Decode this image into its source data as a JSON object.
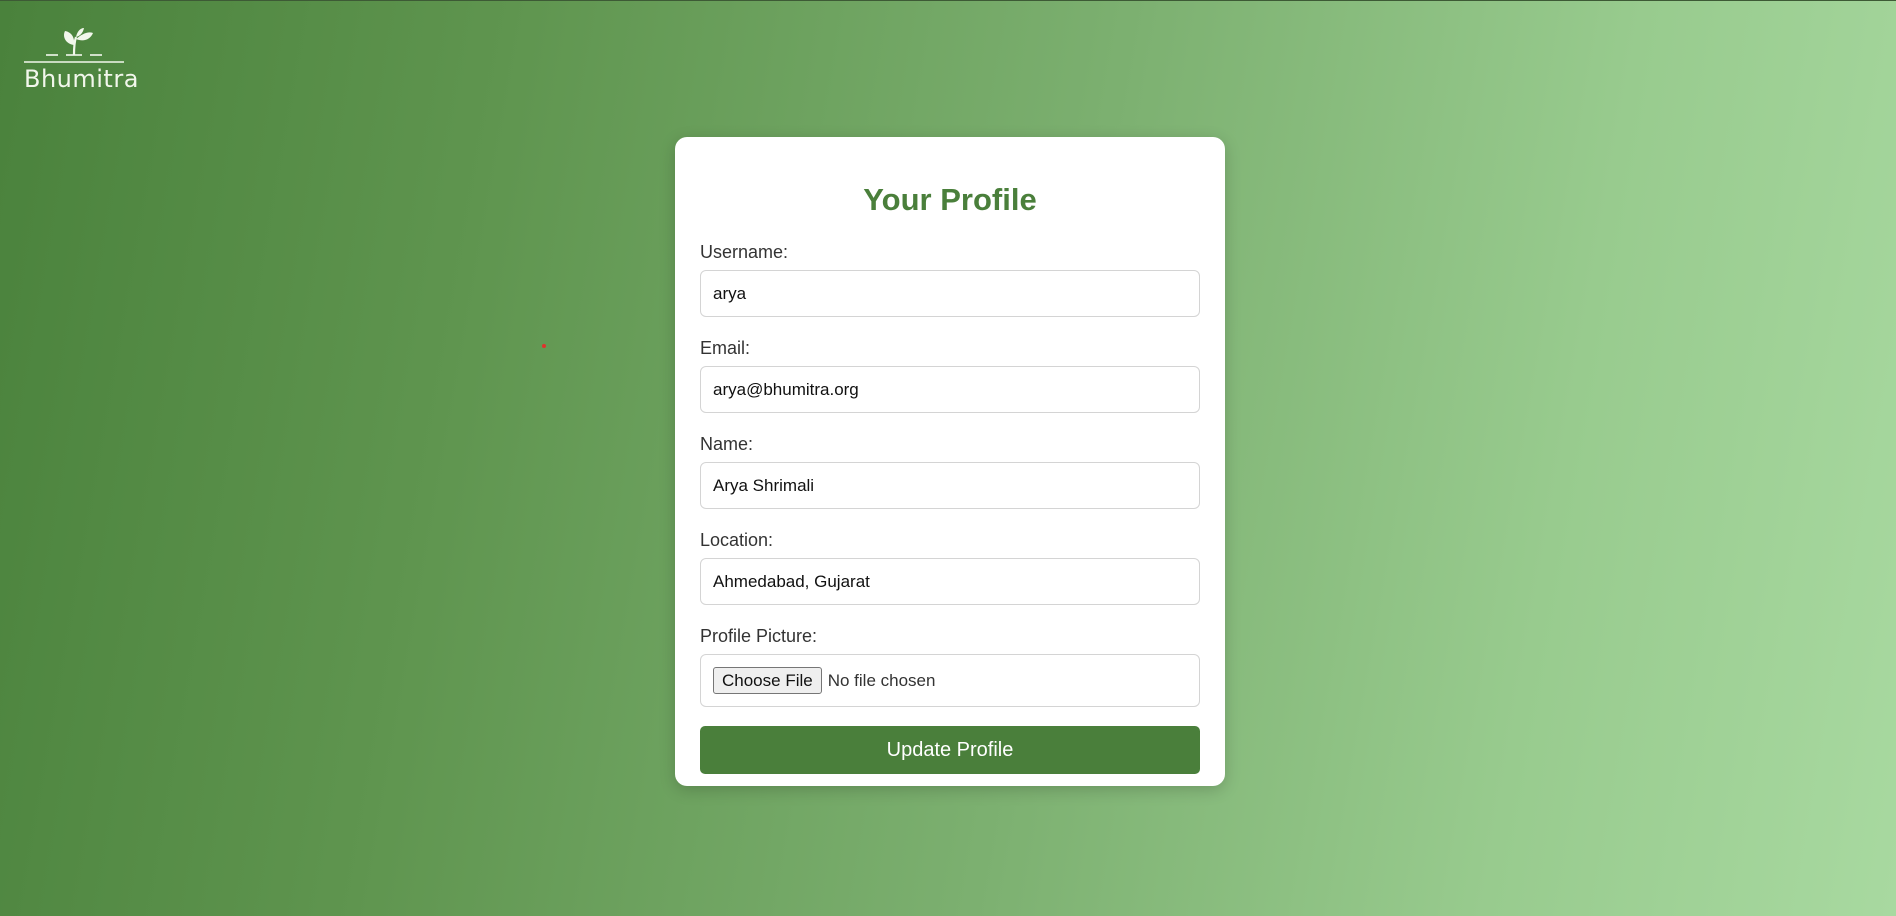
{
  "brand": {
    "name": "Bhumitra",
    "icon": "sprout-icon"
  },
  "form": {
    "title": "Your Profile",
    "fields": {
      "username": {
        "label": "Username:",
        "value": "arya"
      },
      "email": {
        "label": "Email:",
        "value": "arya@bhumitra.org"
      },
      "name": {
        "label": "Name:",
        "value": "Arya Shrimali"
      },
      "location": {
        "label": "Location:",
        "value": "Ahmedabad, Gujarat"
      },
      "profile_picture": {
        "label": "Profile Picture:",
        "button_label": "Choose File",
        "status": "No file chosen"
      }
    },
    "submit_label": "Update Profile"
  },
  "colors": {
    "accent": "#4a7f3b",
    "background_start": "#4a823c",
    "background_end": "#a8d9a0",
    "card": "#ffffff"
  }
}
